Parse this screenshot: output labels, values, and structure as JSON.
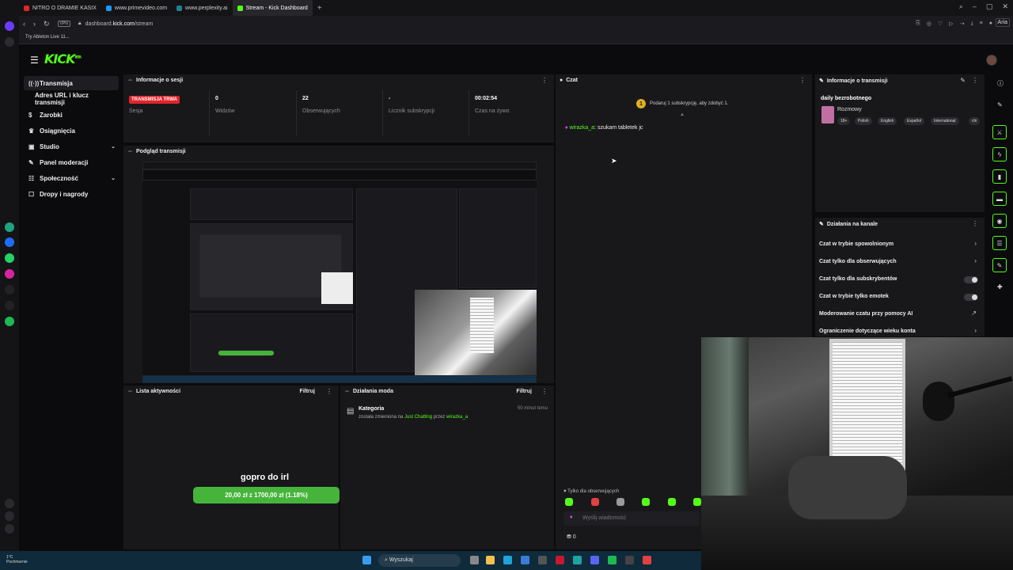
{
  "browser": {
    "tabs": [
      {
        "label": "NITRO O DRAMIE KASIX",
        "color": "#e3242b"
      },
      {
        "label": "www.primevideo.com",
        "color": "#1a98ff"
      },
      {
        "label": "www.perplexity.ai",
        "color": "#20808d"
      },
      {
        "label": "Stream - Kick Dashboard",
        "color": "#53fc18"
      }
    ],
    "new_tab": "+",
    "url_prefix": "dashboard.",
    "url_domain": "kick.com",
    "url_path": "/stream",
    "vpn_label": "VPN",
    "bookmark": "Try Ableton Live 11...",
    "ai_label": "Aria"
  },
  "kick": {
    "logo": "KICK",
    "beta": "BETA"
  },
  "sidebar": {
    "items": [
      {
        "label": "Transmisja",
        "icon": "broadcast-icon"
      },
      {
        "label": "Adres URL i klucz transmisji"
      },
      {
        "label": "Zarobki",
        "icon": "dollar-icon"
      },
      {
        "label": "Osiągnięcia",
        "icon": "trophy-icon"
      },
      {
        "label": "Studio",
        "icon": "studio-icon"
      },
      {
        "label": "Panel moderacji",
        "icon": "wrench-icon"
      },
      {
        "label": "Społeczność",
        "icon": "community-icon"
      },
      {
        "label": "Dropy i nagrody",
        "icon": "gift-icon"
      }
    ]
  },
  "session": {
    "title": "Informacje o sesji",
    "live_badge": "TRANSMISJA TRWA",
    "session_label": "Sesja",
    "stats": [
      {
        "value": "0",
        "label": "Widzów"
      },
      {
        "value": "22",
        "label": "Obserwujących"
      },
      {
        "value": "-",
        "label": "Licznik subskrypcji"
      },
      {
        "value": "00:02:54",
        "label": "Czas na żywo"
      }
    ]
  },
  "preview": {
    "title": "Podgląd transmisji"
  },
  "activity": {
    "title": "Lista aktywności",
    "filter": "Filtruj",
    "goal_title": "gopro do irl",
    "goal_text": "20,00 zł z 1700,00 zł (1.18%)",
    "goal_progress": 0.0118
  },
  "mod_actions": {
    "title": "Działania moda",
    "filter": "Filtruj",
    "item_title": "Kategoria",
    "item_time": "50 minut temu",
    "item_text_1": "została zmieniona na ",
    "item_category": "Just Chatting",
    "item_text_2": " przez ",
    "item_user": "wirazka_a"
  },
  "chat": {
    "title": "Czat",
    "promo": "Podaruj 1 subskrypcję, aby zdobyć 1.",
    "promo_badge": "1",
    "message_user": "wirazka_a",
    "message_sep": ":",
    "message_text": " szukam tabletek jc",
    "followers_only": "Tylko dla obserwujących",
    "input_placeholder": "Wyślij wiadomość",
    "points": "0"
  },
  "stream_info": {
    "title": "Informacje o transmisji",
    "stream_title": "daily bezrobotnego",
    "category": "Rozmowy",
    "tags": [
      "18+",
      "Polish",
      "English",
      "Español",
      "International",
      "chi"
    ]
  },
  "channel_actions": {
    "title": "Działania na kanale",
    "items": [
      {
        "label": "Czat w trybie spowolnionym",
        "control": "›"
      },
      {
        "label": "Czat tylko dla obserwujących",
        "control": "›"
      },
      {
        "label": "Czat tylko dla subskrybentów",
        "control": "toggle"
      },
      {
        "label": "Czat w trybie tylko emotek",
        "control": "toggle"
      },
      {
        "label": "Moderowanie czatu przy pomocy AI",
        "control": "↗"
      },
      {
        "label": "Ograniczenie dotyczące wieku konta",
        "control": "›"
      }
    ]
  },
  "taskbar": {
    "search": "Wyszukaj",
    "weather_temp": "1°C",
    "weather_desc": "Pochmurnie"
  },
  "colors": {
    "accent": "#53fc18",
    "live": "#e3242b",
    "panel": "#18181b",
    "bg": "#0b0b0d"
  }
}
